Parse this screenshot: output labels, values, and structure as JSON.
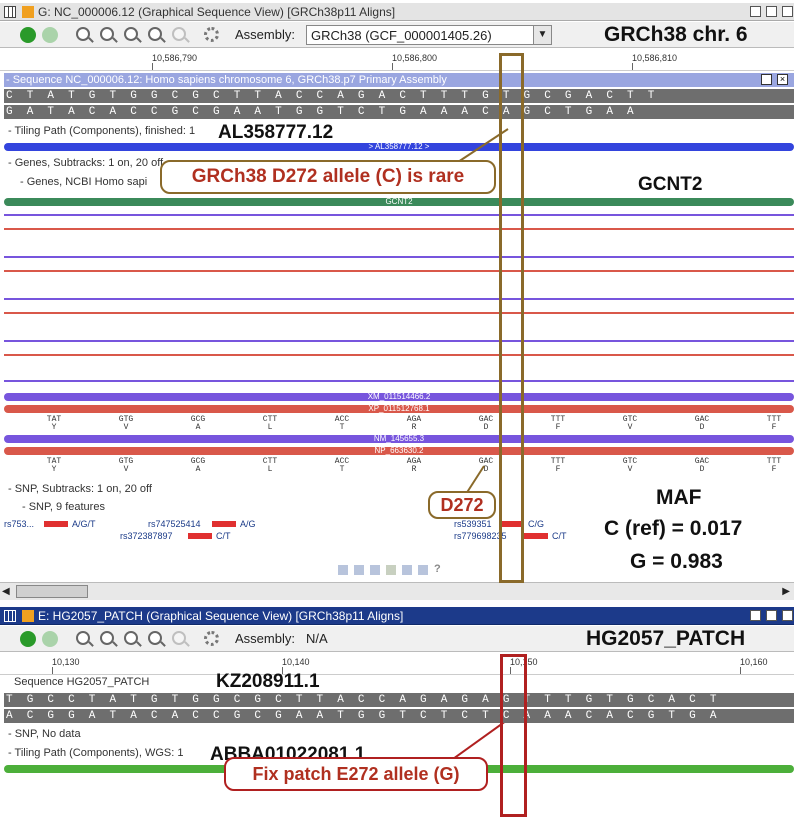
{
  "top": {
    "title": "G: NC_000006.12 (Graphical Sequence View) [GRCh38p11 Aligns]",
    "assembly_label": "Assembly:",
    "assembly_value": "GRCh38 (GCF_000001405.26)",
    "heading": "GRCh38 chr. 6",
    "ruler": [
      "10,586,790",
      "10,586,800",
      "10,586,810"
    ],
    "seq_header": "- Sequence NC_000006.12: Homo sapiens chromosome 6, GRCh38.p7 Primary Assembly",
    "seq_top": "CTATGTGGCGCTTACCAGACTTTGTGCGACTT",
    "seq_bottom": "GATACACCGCGAATGGTCTGAAACAGCTGAA",
    "tiling_label": "- Tiling Path (Components), finished: 1",
    "tiling_name": "AL358777.12",
    "tiling_bar": "> AL358777.12 >",
    "genes_label": "- Genes, Subtracks: 1 on, 20 off",
    "genes_sub": "- Genes, NCBI Homo sapi",
    "genes_sub_end": "n",
    "gene_name": "GCNT2",
    "gene_bar": "GCNT2",
    "xm1": "XM_011514466.2",
    "xp1": "XP_011512768.1",
    "nm1": "NM_145655.3",
    "np1": "NP_663630.2",
    "codons": [
      "TAT",
      "GTG",
      "GCG",
      "CTT",
      "ACC",
      "AGA",
      "GAC",
      "TTT",
      "GTC",
      "GAC",
      "TTT"
    ],
    "aas": [
      "Y",
      "V",
      "A",
      "L",
      "T",
      "R",
      "D",
      "F",
      "V",
      "D",
      "F"
    ],
    "snp_label": "- SNP, Subtracks: 1 on, 20 off",
    "snp_sub": "- SNP, 9 features",
    "snps": [
      {
        "id": "rs753...",
        "allele": "A/G/T"
      },
      {
        "id": "rs747525414",
        "allele": "A/G"
      },
      {
        "id": "rs372387897",
        "allele": "C/T"
      },
      {
        "id": "rs539351",
        "allele": "C/G"
      },
      {
        "id": "rs779698235",
        "allele": "C/T"
      }
    ],
    "callout1": "GRCh38 D272 allele (C) is rare",
    "callout2": "D272",
    "maf_title": "MAF",
    "maf_c": "C (ref) = 0.017",
    "maf_g": "G = 0.983",
    "help": "?"
  },
  "bottom": {
    "title": "E: HG2057_PATCH (Graphical Sequence View) [GRCh38p11 Aligns]",
    "assembly_label": "Assembly:",
    "assembly_value": "N/A",
    "heading": "HG2057_PATCH",
    "ruler": [
      "10,130",
      "10,140",
      "10,150",
      "10,160"
    ],
    "seq_label": "Sequence HG2057_PATCH",
    "seq_name": "KZ208911.1",
    "seq_top": "TGCCTATGTGGCGCTTACCAGAGAGTTTGTGCACT",
    "seq_bottom": "ACGGATACACCGCGAATGGTCTCTCAAACACGTGA",
    "snp_label": "- SNP, No data",
    "tiling_label": "- Tiling Path (Components), WGS: 1",
    "tiling_name": "ABBA01022081.1",
    "tiling_bar": "> ABBA01022081.1 >",
    "callout": "Fix patch E272 allele (G)"
  },
  "colors": {
    "purple": "#7755dd",
    "red": "#d9584a",
    "green": "#4caf3a",
    "gene": "#3b8a5a",
    "blue": "#3344dd"
  }
}
